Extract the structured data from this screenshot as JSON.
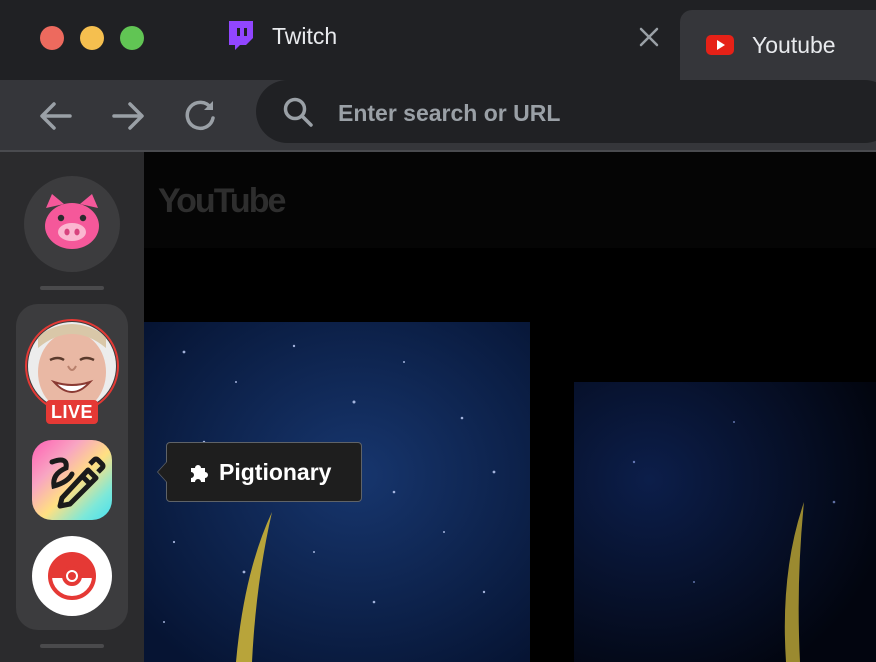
{
  "window": {
    "traffic_lights": {
      "close": "#ed6a5e",
      "minimize": "#f5bf4f",
      "maximize": "#61c554"
    }
  },
  "tabs": [
    {
      "label": "Twitch",
      "icon": "twitch-icon",
      "color": "#9146ff",
      "active": false
    },
    {
      "label": "Youtube",
      "icon": "youtube-icon",
      "color": "#e62117",
      "active": true
    }
  ],
  "toolbar": {
    "search_placeholder": "Enter search or URL",
    "back_icon": "arrow-left-icon",
    "forward_icon": "arrow-right-icon",
    "reload_icon": "reload-icon"
  },
  "sidebar": {
    "home_icon": "pig-icon",
    "home_color": "#f5589a",
    "live_badge": "LIVE",
    "live_color": "#e53935",
    "apps": [
      {
        "name": "Pigtionary",
        "icon": "draw-pencil-icon"
      },
      {
        "name": "Pokeball",
        "icon": "pokeball-icon",
        "color": "#e53935"
      }
    ]
  },
  "content": {
    "logo_text": "YouTube"
  },
  "tooltip": {
    "icon": "puzzle-icon",
    "label": "Pigtionary"
  }
}
